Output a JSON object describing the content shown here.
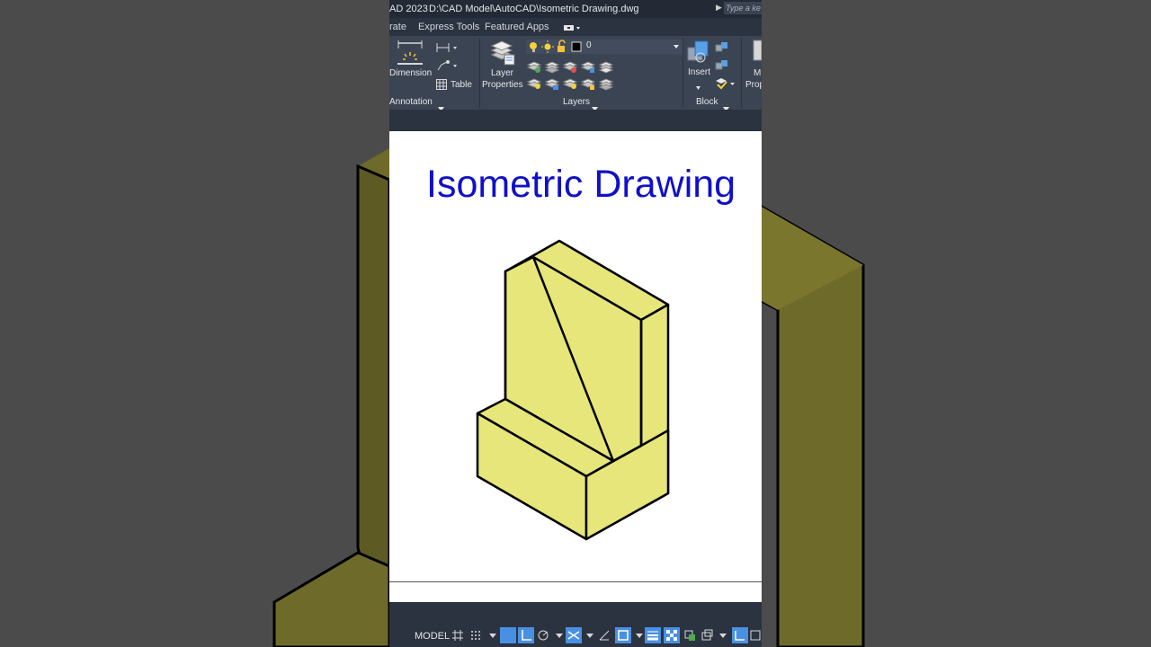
{
  "window": {
    "app_title_fragment": "AD 2023",
    "file_path": "D:\\CAD Model\\AutoCAD\\Isometric Drawing.dwg",
    "search_placeholder": "Type a ke"
  },
  "tabs": [
    "rate",
    "Express Tools",
    "Featured Apps"
  ],
  "ribbon": {
    "annotation": {
      "dimension_label": "Dimension",
      "table_label": "Table",
      "panel_label": "Annotation"
    },
    "layers": {
      "layer_properties_line1": "Layer",
      "layer_properties_line2": "Properties",
      "current_layer": "0",
      "panel_label": "Layers"
    },
    "block": {
      "insert_label": "Insert",
      "panel_label": "Block",
      "match_properties_line1": "M",
      "match_properties_line2": "Prop"
    }
  },
  "drawing": {
    "title": "Isometric Drawing",
    "title_color": "#1010c8",
    "fill_color": "#e6e67a"
  },
  "statusbar": {
    "model_label": "MODEL"
  }
}
